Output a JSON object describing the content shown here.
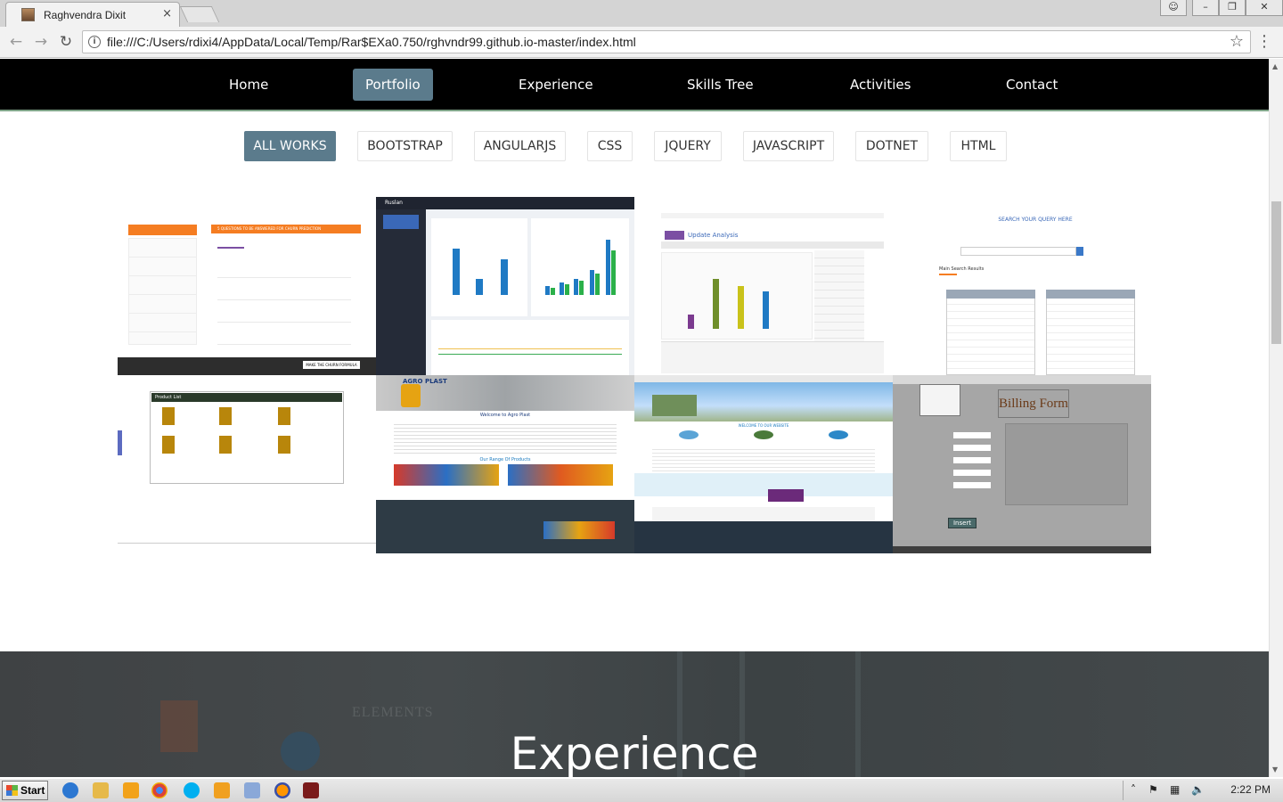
{
  "browser": {
    "tab_title": "Raghvendra Dixit",
    "tab_close": "×",
    "url": "file:///C:/Users/rdixi4/AppData/Local/Temp/Rar$EXa0.750/rghvndr99.github.io-master/index.html"
  },
  "nav": {
    "items": [
      {
        "label": "Home",
        "active": false
      },
      {
        "label": "Portfolio",
        "active": true
      },
      {
        "label": "Experience",
        "active": false
      },
      {
        "label": "Skills Tree",
        "active": false
      },
      {
        "label": "Activities",
        "active": false
      },
      {
        "label": "Contact",
        "active": false
      }
    ]
  },
  "filters": {
    "items": [
      {
        "label": "ALL WORKS",
        "active": true
      },
      {
        "label": "BOOTSTRAP",
        "active": false
      },
      {
        "label": "ANGULARJS",
        "active": false
      },
      {
        "label": "CSS",
        "active": false
      },
      {
        "label": "JQUERY",
        "active": false
      },
      {
        "label": "JAVASCRIPT",
        "active": false
      },
      {
        "label": "DOTNET",
        "active": false
      },
      {
        "label": "HTML",
        "active": false
      }
    ]
  },
  "portfolio": {
    "tiles": [
      {
        "name": "churn-prediction",
        "heading": "5 QUESTIONS TO BE ANSWERED FOR CHURN PREDICTION",
        "button": "MAKE THE CHURN FORMULA"
      },
      {
        "name": "analytics-dashboard",
        "heading": "Ruslan"
      },
      {
        "name": "update-analysis",
        "heading": "Update Analysis"
      },
      {
        "name": "search-query",
        "heading": "SEARCH YOUR QUERY HERE",
        "sub": "Main Search Results"
      },
      {
        "name": "product-list",
        "heading": "Product List"
      },
      {
        "name": "agro-plast",
        "heading": "AGRO PLAST",
        "sub": "Welcome to Agro Plast",
        "sub2": "Our Range Of Products"
      },
      {
        "name": "industrial-site",
        "heading": "WELCOME TO OUR WEBSITE"
      },
      {
        "name": "billing-form",
        "heading": "Billing Form",
        "button": "Insert"
      }
    ]
  },
  "experience": {
    "title": "Experience",
    "ghost_text": "ELEMENTS"
  },
  "taskbar": {
    "start_label": "Start",
    "clock": "2:22 PM"
  },
  "colors": {
    "nav_bg": "#000000",
    "accent": "#5b7b8c",
    "exp_bg": "#404446"
  }
}
